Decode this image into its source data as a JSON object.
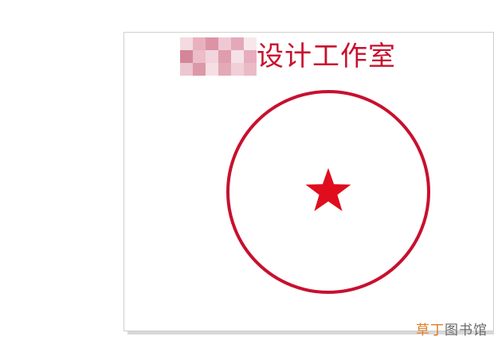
{
  "document": {
    "title_suffix": "设计工作室",
    "title_prefix_redacted": true
  },
  "stamp": {
    "ring_color": "#c8102e",
    "star_color": "#e00d1d",
    "icon": "red-star-icon"
  },
  "watermark": {
    "part1": "草丁",
    "part2": "图书馆",
    "color1": "#e07b24",
    "color2": "#6a6a6a"
  },
  "colors": {
    "accent": "#c8102e",
    "mosaic": [
      "#f3d6de",
      "#e7a9b8",
      "#d9899c",
      "#efc3cf",
      "#e2a0b1",
      "#f7e5ea",
      "#cf7a90",
      "#e9b6c3",
      "#f1d0d9",
      "#dc93a6",
      "#f5dfe6",
      "#e5a5b5",
      "#eac0cb",
      "#d88da0",
      "#f4dbe2",
      "#e0a0b0",
      "#f0cad4",
      "#e8b4c1"
    ]
  }
}
